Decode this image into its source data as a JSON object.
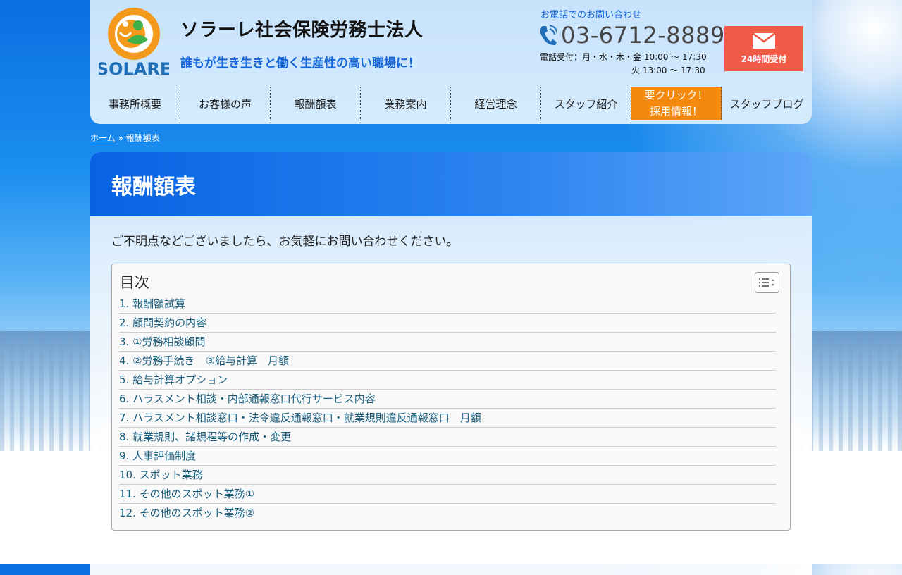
{
  "header": {
    "site_title": "ソラーレ社会保険労務士法人",
    "tagline": "誰もが生き生きと働く生産性の高い職場に！",
    "logo_text": "SOLARE",
    "contact_heading": "お電話でのお問い合わせ",
    "phone": "03-6712-8889",
    "hours_line1": "電話受付：月・水・木・金 10:00 〜 17:30",
    "hours_line2": "火 13:00 〜 17:30",
    "mail_button_label": "24時間受付",
    "mail_button_color": "#f15a47"
  },
  "nav": {
    "items": [
      {
        "label": "事務所概要"
      },
      {
        "label": "お客様の声"
      },
      {
        "label": "報酬額表"
      },
      {
        "label": "業務案内"
      },
      {
        "label": "経営理念"
      },
      {
        "label": "スタッフ紹介"
      },
      {
        "label_line1": "要クリック！",
        "label_line2": "採用情報！"
      },
      {
        "label": "スタッフブログ"
      }
    ],
    "highlight_color": "#f5890e"
  },
  "breadcrumb": {
    "home": "ホーム",
    "separator": " » ",
    "current": "報酬額表"
  },
  "main": {
    "page_title": "報酬額表",
    "intro": "ご不明点などございましたら、お気軽にお問い合わせください。",
    "toc": {
      "title": "目次",
      "items": [
        "1. 報酬額試算",
        "2. 顧問契約の内容",
        "3. ①労務相談顧問",
        "4. ②労務手続き　③給与計算　月額",
        "5. 給与計算オプション",
        "6. ハラスメント相談・内部通報窓口代行サービス内容",
        "7. ハラスメント相談窓口・法令違反通報窓口・就業規則違反通報窓口　月額",
        "8. 就業規則、諸規程等の作成・変更",
        "9. 人事評価制度",
        "10. スポット業務",
        "11. その他のスポット業務①",
        "12. その他のスポット業務②"
      ]
    }
  },
  "colors": {
    "accent_blue": "#1565d8",
    "title_bar": "#0763e3",
    "toc_link": "#175d7e"
  },
  "icons": [
    "phone-icon",
    "mail-icon",
    "list-icon",
    "solare-logo"
  ]
}
